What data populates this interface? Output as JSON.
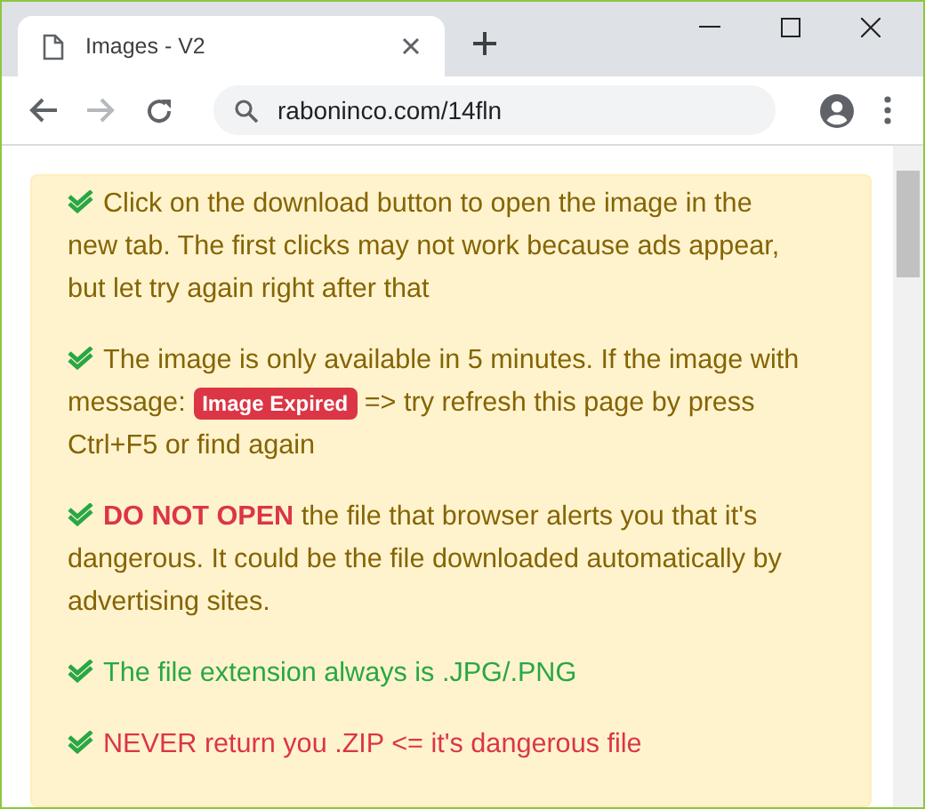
{
  "tab": {
    "title": "Images - V2"
  },
  "address_bar": {
    "url": "raboninco.com/14fln"
  },
  "notices": [
    {
      "kind": "normal",
      "parts": [
        {
          "kind": "text",
          "text": "Click on the download button to open the image in the new tab. The first clicks may not work because ads appear, but let try again right after that"
        }
      ]
    },
    {
      "kind": "normal",
      "parts": [
        {
          "kind": "text",
          "text": "The image is only available in 5 minutes. If the image with message: "
        },
        {
          "kind": "badge",
          "text": "Image Expired"
        },
        {
          "kind": "text",
          "text": " => try refresh this page by press Ctrl+F5 or find again"
        }
      ]
    },
    {
      "kind": "normal",
      "parts": [
        {
          "kind": "strong",
          "text": "DO NOT OPEN"
        },
        {
          "kind": "text",
          "text": " the file that browser alerts you that it's dangerous. It could be the file downloaded automatically by advertising sites."
        }
      ]
    },
    {
      "kind": "success",
      "parts": [
        {
          "kind": "text",
          "text": "The file extension always is .JPG/.PNG"
        }
      ]
    },
    {
      "kind": "danger",
      "parts": [
        {
          "kind": "text",
          "text": "NEVER return you .ZIP <= it's dangerous file"
        }
      ]
    }
  ]
}
